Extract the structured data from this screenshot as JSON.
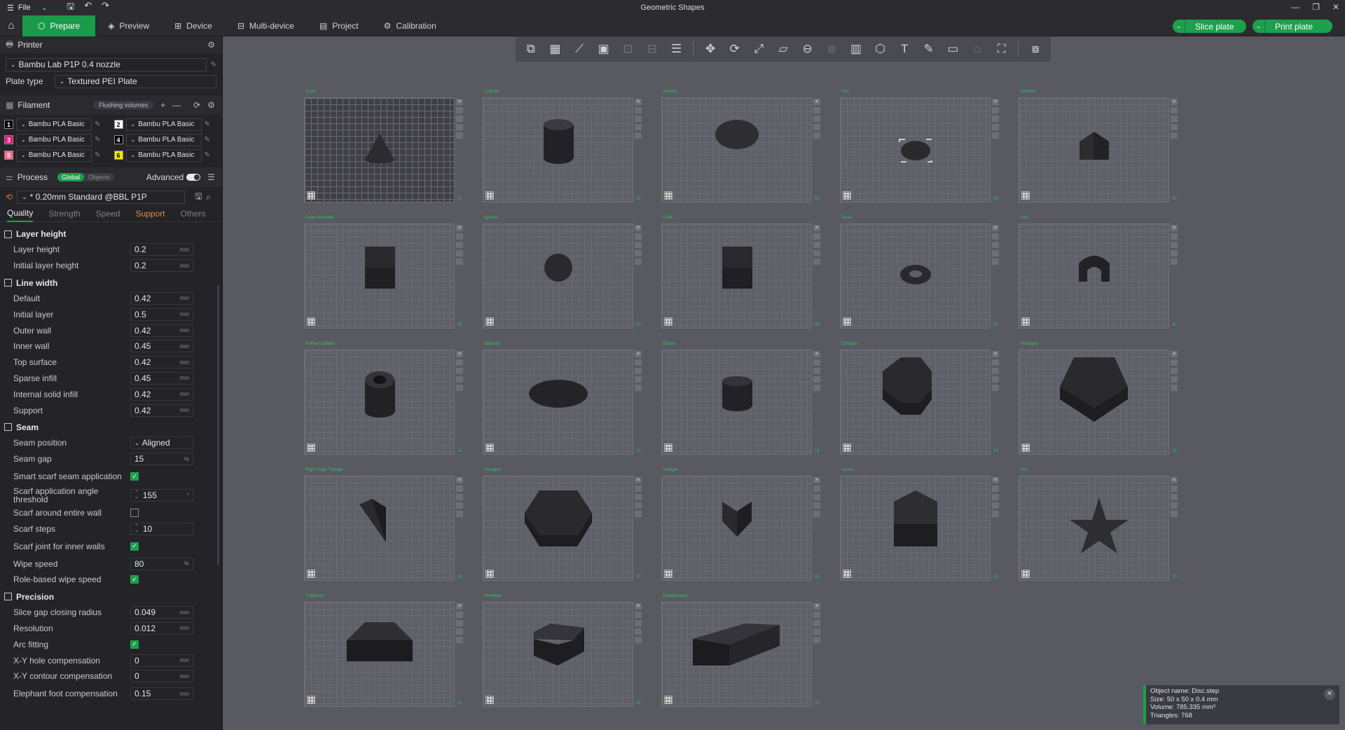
{
  "window": {
    "title": "Geometric Shapes",
    "file_menu": "File"
  },
  "nav": {
    "tabs": [
      {
        "label": "Prepare",
        "icon": "cube-icon"
      },
      {
        "label": "Preview",
        "icon": "layers-icon"
      },
      {
        "label": "Device",
        "icon": "device-icon"
      },
      {
        "label": "Multi-device",
        "icon": "multi-device-icon"
      },
      {
        "label": "Project",
        "icon": "project-icon"
      },
      {
        "label": "Calibration",
        "icon": "calibration-icon"
      }
    ],
    "slice_label": "Slice plate",
    "print_label": "Print plate"
  },
  "printer": {
    "header": "Printer",
    "name": "Bambu Lab P1P 0.4 nozzle",
    "plate_type_label": "Plate type",
    "plate_type": "Textured PEI Plate"
  },
  "filament": {
    "header": "Filament",
    "flushing_label": "Flushing volumes",
    "slots": [
      {
        "num": "1",
        "color": "#000000",
        "text_color": "#ffffff",
        "name": "Bambu PLA Basic"
      },
      {
        "num": "2",
        "color": "#ffffff",
        "text_color": "#000000",
        "name": "Bambu PLA Basic"
      },
      {
        "num": "3",
        "color": "#e8177a",
        "text_color": "#ffffff",
        "name": "Bambu PLA Basic"
      },
      {
        "num": "4",
        "color": "#000000",
        "text_color": "#ffffff",
        "name": "Bambu PLA Basic"
      },
      {
        "num": "5",
        "color": "#f06a8a",
        "text_color": "#ffffff",
        "name": "Bambu PLA Basic"
      },
      {
        "num": "6",
        "color": "#f5e50a",
        "text_color": "#000000",
        "name": "Bambu PLA Basic"
      }
    ]
  },
  "process": {
    "header": "Process",
    "global_label": "Global",
    "objects_label": "Objects",
    "advanced_label": "Advanced",
    "preset": "* 0.20mm Standard @BBL P1P",
    "tabs": [
      "Quality",
      "Strength",
      "Speed",
      "Support",
      "Others"
    ],
    "groups": [
      {
        "title": "Layer height",
        "rows": [
          {
            "label": "Layer height",
            "value": "0.2",
            "unit": "mm"
          },
          {
            "label": "Initial layer height",
            "value": "0.2",
            "unit": "mm"
          }
        ]
      },
      {
        "title": "Line width",
        "rows": [
          {
            "label": "Default",
            "value": "0.42",
            "unit": "mm"
          },
          {
            "label": "Initial layer",
            "value": "0.5",
            "unit": "mm"
          },
          {
            "label": "Outer wall",
            "value": "0.42",
            "unit": "mm"
          },
          {
            "label": "Inner wall",
            "value": "0.45",
            "unit": "mm"
          },
          {
            "label": "Top surface",
            "value": "0.42",
            "unit": "mm"
          },
          {
            "label": "Sparse infill",
            "value": "0.45",
            "unit": "mm"
          },
          {
            "label": "Internal solid infill",
            "value": "0.42",
            "unit": "mm"
          },
          {
            "label": "Support",
            "value": "0.42",
            "unit": "mm"
          }
        ]
      },
      {
        "title": "Seam",
        "rows": [
          {
            "label": "Seam position",
            "value": "Aligned",
            "type": "select"
          },
          {
            "label": "Seam gap",
            "value": "15",
            "unit": "%"
          },
          {
            "label": "Smart scarf seam application",
            "type": "check",
            "checked": true
          },
          {
            "label": "Scarf application angle threshold",
            "value": "155",
            "unit": "°",
            "type": "spin"
          },
          {
            "label": "Scarf around entire wall",
            "type": "check",
            "checked": false
          },
          {
            "label": "Scarf steps",
            "value": "10",
            "type": "spin"
          },
          {
            "label": "Scarf joint for inner walls",
            "type": "check",
            "checked": true
          },
          {
            "label": "Wipe speed",
            "value": "80",
            "unit": "%"
          },
          {
            "label": "Role-based wipe speed",
            "type": "check",
            "checked": true
          }
        ]
      },
      {
        "title": "Precision",
        "rows": [
          {
            "label": "Slice gap closing radius",
            "value": "0.049",
            "unit": "mm"
          },
          {
            "label": "Resolution",
            "value": "0.012",
            "unit": "mm"
          },
          {
            "label": "Arc fitting",
            "type": "check",
            "checked": true
          },
          {
            "label": "X-Y hole compensation",
            "value": "0",
            "unit": "mm"
          },
          {
            "label": "X-Y contour compensation",
            "value": "0",
            "unit": "mm"
          },
          {
            "label": "Elephant foot compensation",
            "value": "0.15",
            "unit": "mm"
          }
        ]
      }
    ]
  },
  "plates": [
    {
      "name": "Cone",
      "num": "01",
      "shape": "cone"
    },
    {
      "name": "Cylinder",
      "num": "02",
      "shape": "cylinder"
    },
    {
      "name": "Ovaloid",
      "num": "03",
      "shape": "ovaloid"
    },
    {
      "name": "Disc",
      "num": "04",
      "shape": "disc"
    },
    {
      "name": "Pyramid",
      "num": "05",
      "shape": "pyramid"
    },
    {
      "name": "Cube Rounded",
      "num": "06",
      "shape": "cube"
    },
    {
      "name": "Sphere",
      "num": "07",
      "shape": "sphere"
    },
    {
      "name": "Cube",
      "num": "08",
      "shape": "cube"
    },
    {
      "name": "Torus",
      "num": "09",
      "shape": "torus"
    },
    {
      "name": "Arch",
      "num": "10",
      "shape": "arch"
    },
    {
      "name": "Hollow Cylinder",
      "num": "11",
      "shape": "hollow"
    },
    {
      "name": "Ellipsoid",
      "num": "12",
      "shape": "ellipsoid"
    },
    {
      "name": "Ellipse",
      "num": "13",
      "shape": "ellipse"
    },
    {
      "name": "Octagon",
      "num": "14",
      "shape": "octagon"
    },
    {
      "name": "Pentagon",
      "num": "15",
      "shape": "pentagon"
    },
    {
      "name": "Right Angle Triangle",
      "num": "16",
      "shape": "wedge"
    },
    {
      "name": "Hexagon",
      "num": "17",
      "shape": "hexagon"
    },
    {
      "name": "Triangle",
      "num": "18",
      "shape": "triangle"
    },
    {
      "name": "House",
      "num": "19",
      "shape": "house"
    },
    {
      "name": "Star",
      "num": "20",
      "shape": "star"
    },
    {
      "name": "Trapezoid",
      "num": "21",
      "shape": "trapezoid"
    },
    {
      "name": "Rhombus",
      "num": "22",
      "shape": "rhombus"
    },
    {
      "name": "Parallelogram",
      "num": "23",
      "shape": "parallelogram"
    }
  ],
  "info": {
    "name": "Object name: Disc.step",
    "size": "Size: 50 x 50 x 0.4 mm",
    "volume": "Volume: 785.335 mm³",
    "triangles": "Triangles: 768"
  }
}
